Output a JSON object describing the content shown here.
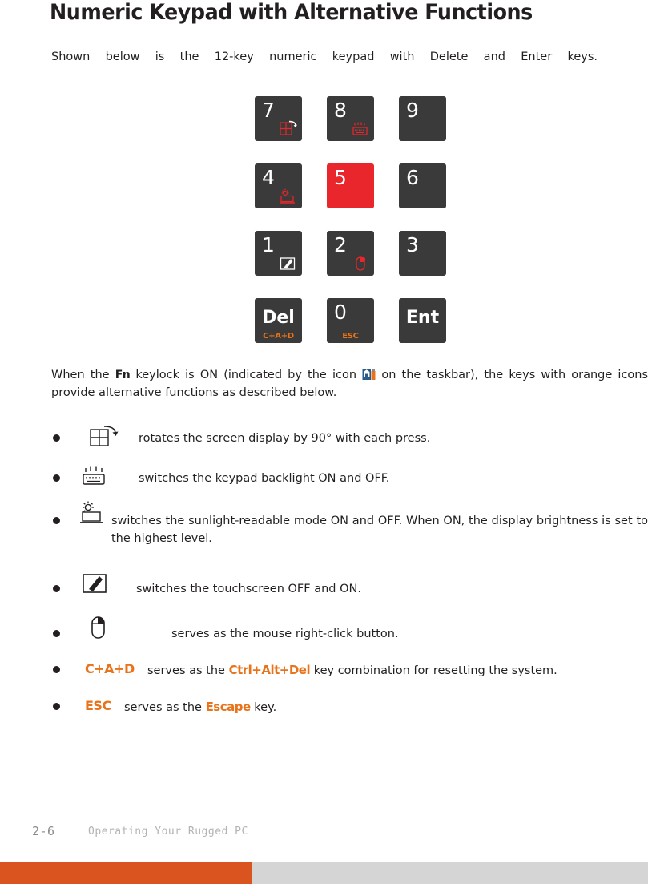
{
  "title": "Numeric Keypad with Alternative Functions",
  "intro": "Shown below is the 12-key numeric keypad with Delete and Enter keys.",
  "keypad": {
    "keys": [
      {
        "id": "key-7",
        "label": "7",
        "sub": "",
        "icon": "rotate-screen-icon"
      },
      {
        "id": "key-8",
        "label": "8",
        "sub": "",
        "icon": "keypad-backlight-icon"
      },
      {
        "id": "key-9",
        "label": "9",
        "sub": "",
        "icon": ""
      },
      {
        "id": "key-4",
        "label": "4",
        "sub": "",
        "icon": "sunlight-readable-icon"
      },
      {
        "id": "key-5",
        "label": "5",
        "sub": "",
        "icon": ""
      },
      {
        "id": "key-6",
        "label": "6",
        "sub": "",
        "icon": ""
      },
      {
        "id": "key-1",
        "label": "1",
        "sub": "",
        "icon": "touchscreen-icon"
      },
      {
        "id": "key-2",
        "label": "2",
        "sub": "",
        "icon": "mouse-right-click-icon"
      },
      {
        "id": "key-3",
        "label": "3",
        "sub": "",
        "icon": ""
      },
      {
        "id": "key-del",
        "label": "Del",
        "sub": "C+A+D",
        "icon": ""
      },
      {
        "id": "key-0",
        "label": "0",
        "sub": "ESC",
        "icon": ""
      },
      {
        "id": "key-ent",
        "label": "Ent",
        "sub": "",
        "icon": ""
      }
    ]
  },
  "mid_paragraph": {
    "part1": "When the",
    "fn_label": "Fn",
    "part2": "keylock is ON (indicated by the icon",
    "part3": "on the taskbar), the keys with orange icons provide alternative functions as described below."
  },
  "bullets": [
    {
      "icon": "rotate-screen-icon",
      "text": "rotates the screen display by 90° with each press."
    },
    {
      "icon": "keypad-backlight-icon",
      "text": "switches the keypad backlight ON and OFF."
    },
    {
      "icon": "sunlight-readable-icon",
      "text": "switches the sunlight-readable mode ON and OFF. When ON, the display brightness is set to the highest level."
    },
    {
      "icon": "touchscreen-icon",
      "text": "switches the touchscreen OFF and ON."
    },
    {
      "icon": "mouse-right-click-icon",
      "text": "serves as the mouse right-click button."
    },
    {
      "icon": "",
      "label": "C+A+D",
      "text_a": "serves as the",
      "emph": "Ctrl+Alt+Del",
      "text_b": "key combination for resetting the system."
    },
    {
      "icon": "",
      "label": "ESC",
      "text_a": "serves as the",
      "emph": "Escape",
      "text_b": "key."
    }
  ],
  "footer": {
    "page_number": "2-6",
    "chapter": "Operating Your Rugged PC"
  },
  "colors": {
    "orange": "#e8731a",
    "red_key": "#e8262b",
    "key_dark": "#3a3a3a",
    "footer_bar": "#d9541e"
  }
}
